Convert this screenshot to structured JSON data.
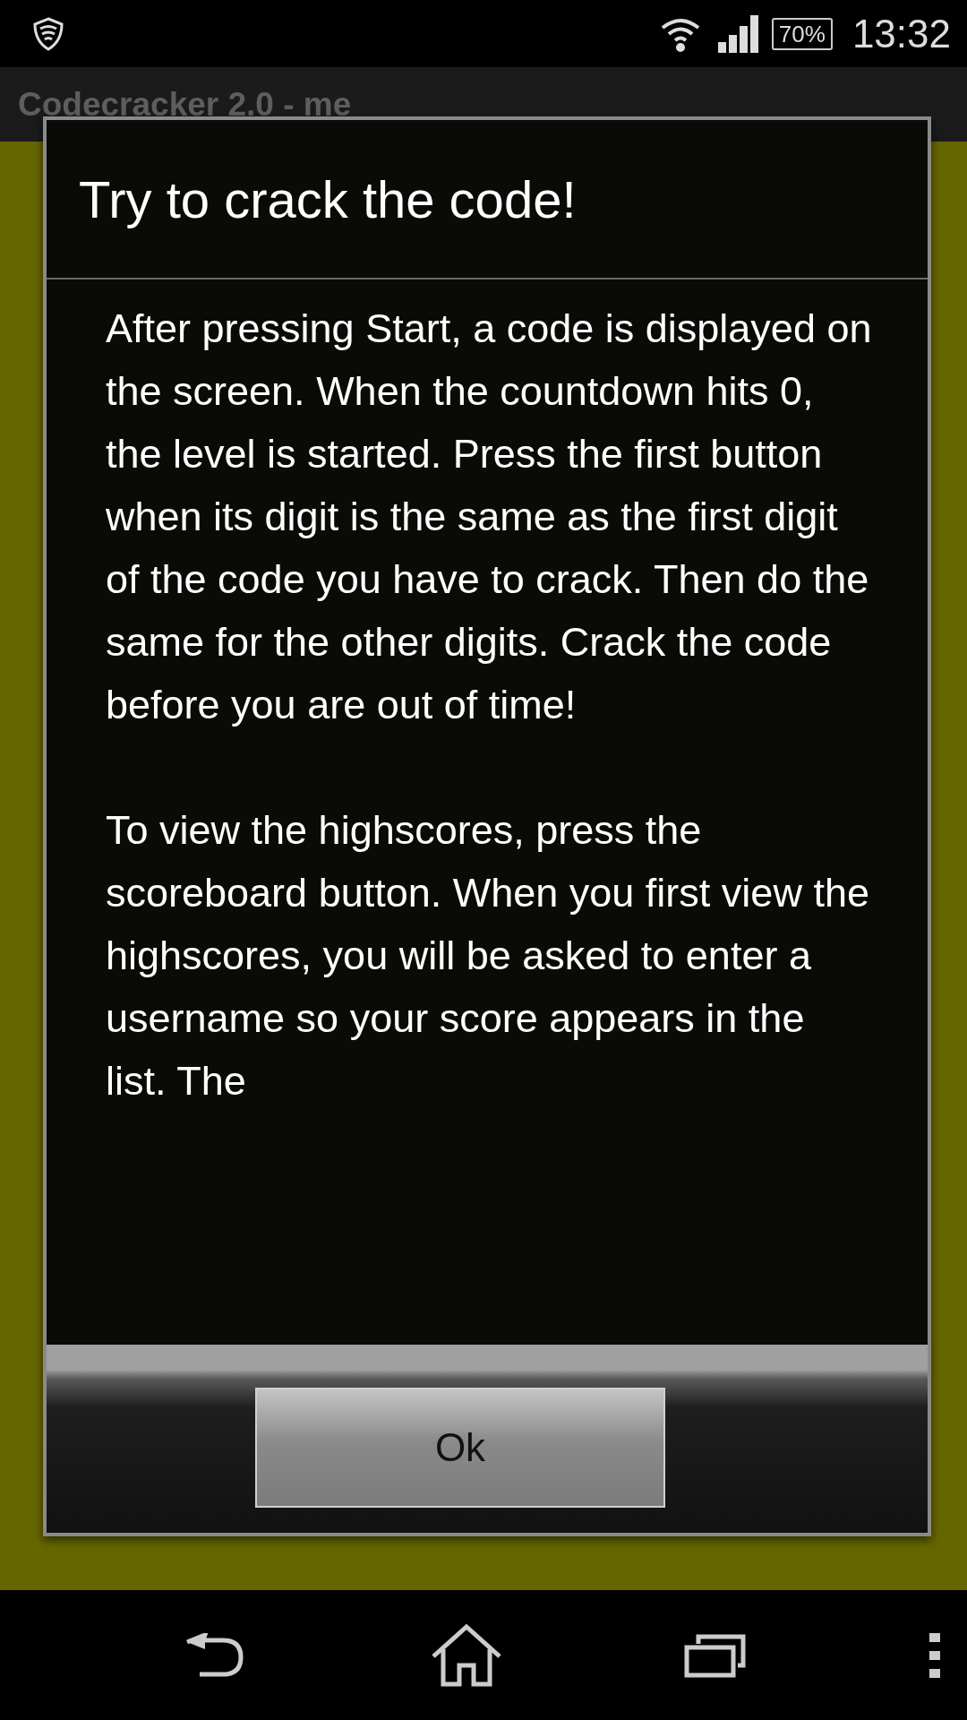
{
  "status_bar": {
    "battery": "70%",
    "time": "13:32"
  },
  "app": {
    "title": "Codecracker 2.0 - me"
  },
  "dialog": {
    "title": "Try to crack the code!",
    "paragraphs": [
      "After pressing Start, a code is displayed on the screen. When the countdown hits 0, the level is started. Press the first button when its digit is the same as the first digit of the code you have to crack. Then do the same for the other digits. Crack the code before you are out of time!",
      "To view the highscores, press the scoreboard button. When you first view the highscores, you will be asked to enter a username so your score appears in the list. The"
    ],
    "button": "Ok"
  }
}
